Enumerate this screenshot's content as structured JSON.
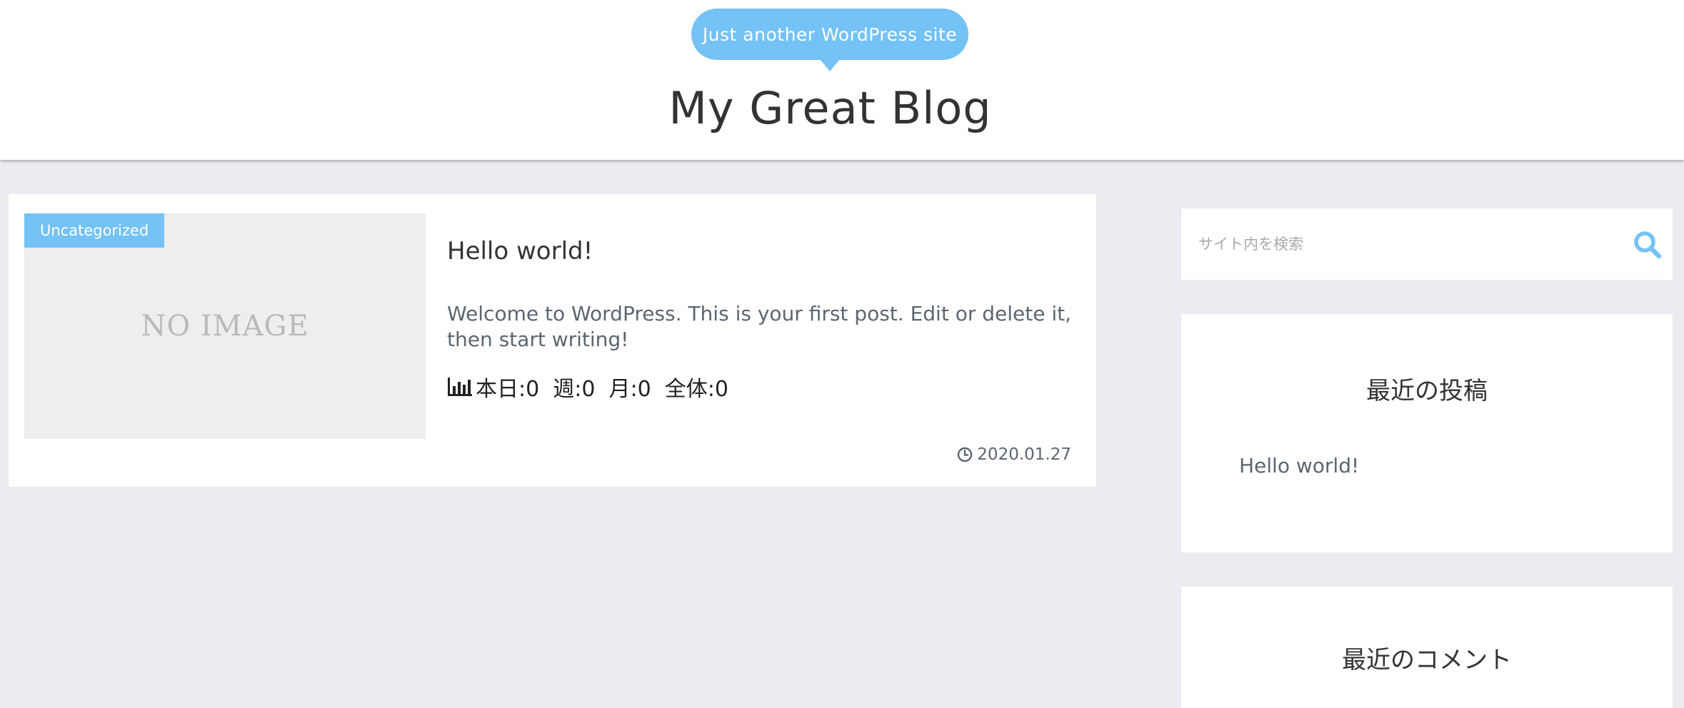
{
  "header": {
    "tagline": "Just another WordPress site",
    "site_title": "My Great Blog"
  },
  "post": {
    "category": "Uncategorized",
    "thumbnail_label": "NO IMAGE",
    "title": "Hello world!",
    "excerpt": "Welcome to WordPress. This is your first post. Edit or delete it, then start writing!",
    "views": "本日:0  週:0  月:0  全体:0",
    "date": "2020.01.27"
  },
  "sidebar": {
    "search": {
      "placeholder": "サイト内を検索"
    },
    "recent_posts": {
      "title": "最近の投稿",
      "items": [
        "Hello world!"
      ]
    },
    "recent_comments": {
      "title": "最近のコメント"
    }
  },
  "colors": {
    "accent": "#74c2f6",
    "background": "#eaecf1",
    "card": "#ffffff",
    "muted_text": "#5b6670"
  },
  "icons": {
    "views": "bar-chart-icon",
    "date": "clock-icon",
    "search": "search-icon"
  }
}
